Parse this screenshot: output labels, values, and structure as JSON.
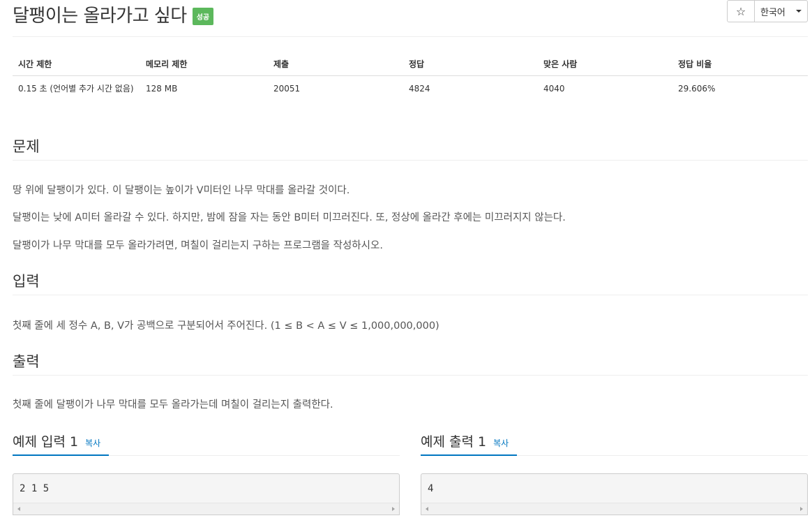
{
  "problem": {
    "title": "달팽이는 올라가고 싶다",
    "badge": "성공"
  },
  "toolbar": {
    "star_icon": "☆",
    "language": "한국어"
  },
  "info_table": {
    "headers": [
      "시간 제한",
      "메모리 제한",
      "제출",
      "정답",
      "맞은 사람",
      "정답 비율"
    ],
    "row": [
      "0.15 초 (언어별 추가 시간 없음)",
      "128 MB",
      "20051",
      "4824",
      "4040",
      "29.606%"
    ]
  },
  "sections": {
    "problem": {
      "title": "문제",
      "paragraphs": [
        "땅 위에 달팽이가 있다. 이 달팽이는 높이가 V미터인 나무 막대를 올라갈 것이다.",
        "달팽이는 낮에 A미터 올라갈 수 있다. 하지만, 밤에 잠을 자는 동안 B미터 미끄러진다. 또, 정상에 올라간 후에는 미끄러지지 않는다.",
        "달팽이가 나무 막대를 모두 올라가려면, 며칠이 걸리는지 구하는 프로그램을 작성하시오."
      ]
    },
    "input": {
      "title": "입력",
      "text": "첫째 줄에 세 정수 A, B, V가 공백으로 구분되어서 주어진다. (1 ≤ B < A ≤ V ≤ 1,000,000,000)"
    },
    "output": {
      "title": "출력",
      "text": "첫째 줄에 달팽이가 나무 막대를 모두 올라가는데 며칠이 걸리는지 출력한다."
    }
  },
  "examples": {
    "input": {
      "title": "예제 입력 1",
      "copy_label": "복사",
      "content": "2 1 5"
    },
    "output": {
      "title": "예제 출력 1",
      "copy_label": "복사",
      "content": "4"
    }
  }
}
